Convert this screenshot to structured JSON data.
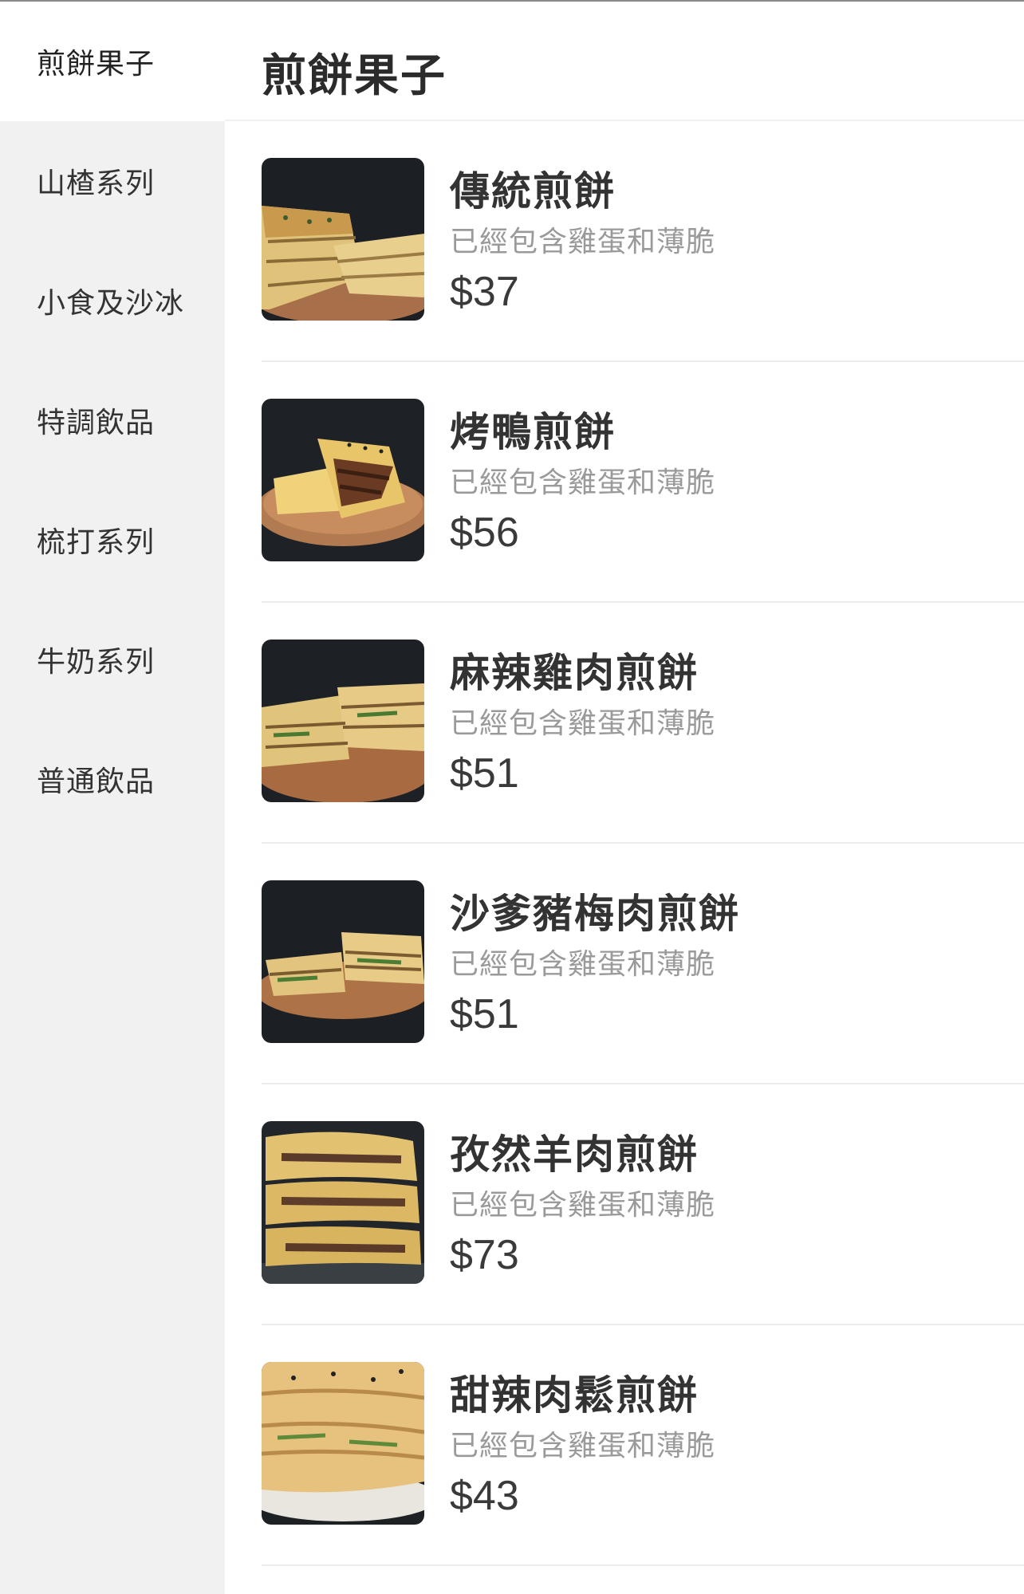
{
  "sidebar": {
    "categories": [
      {
        "label": "煎餅果子",
        "active": true
      },
      {
        "label": "山楂系列",
        "active": false
      },
      {
        "label": "小食及沙冰",
        "active": false
      },
      {
        "label": "特調飲品",
        "active": false
      },
      {
        "label": "梳打系列",
        "active": false
      },
      {
        "label": "牛奶系列",
        "active": false
      },
      {
        "label": "普通飲品",
        "active": false
      }
    ]
  },
  "main": {
    "section_title": "煎餅果子",
    "items": [
      {
        "name": "傳統煎餅",
        "description": "已經包含雞蛋和薄脆",
        "price": "$37"
      },
      {
        "name": "烤鴨煎餅",
        "description": "已經包含雞蛋和薄脆",
        "price": "$56"
      },
      {
        "name": "麻辣雞肉煎餅",
        "description": "已經包含雞蛋和薄脆",
        "price": "$51"
      },
      {
        "name": "沙爹豬梅肉煎餅",
        "description": "已經包含雞蛋和薄脆",
        "price": "$51"
      },
      {
        "name": "孜然羊肉煎餅",
        "description": "已經包含雞蛋和薄脆",
        "price": "$73"
      },
      {
        "name": "甜辣肉鬆煎餅",
        "description": "已經包含雞蛋和薄脆",
        "price": "$43"
      }
    ]
  },
  "colors": {
    "sidebar_bg": "#f1f1f1",
    "active_bg": "#ffffff",
    "text_primary": "#333333",
    "text_secondary": "#9a9a9a",
    "divider": "#ececec"
  }
}
